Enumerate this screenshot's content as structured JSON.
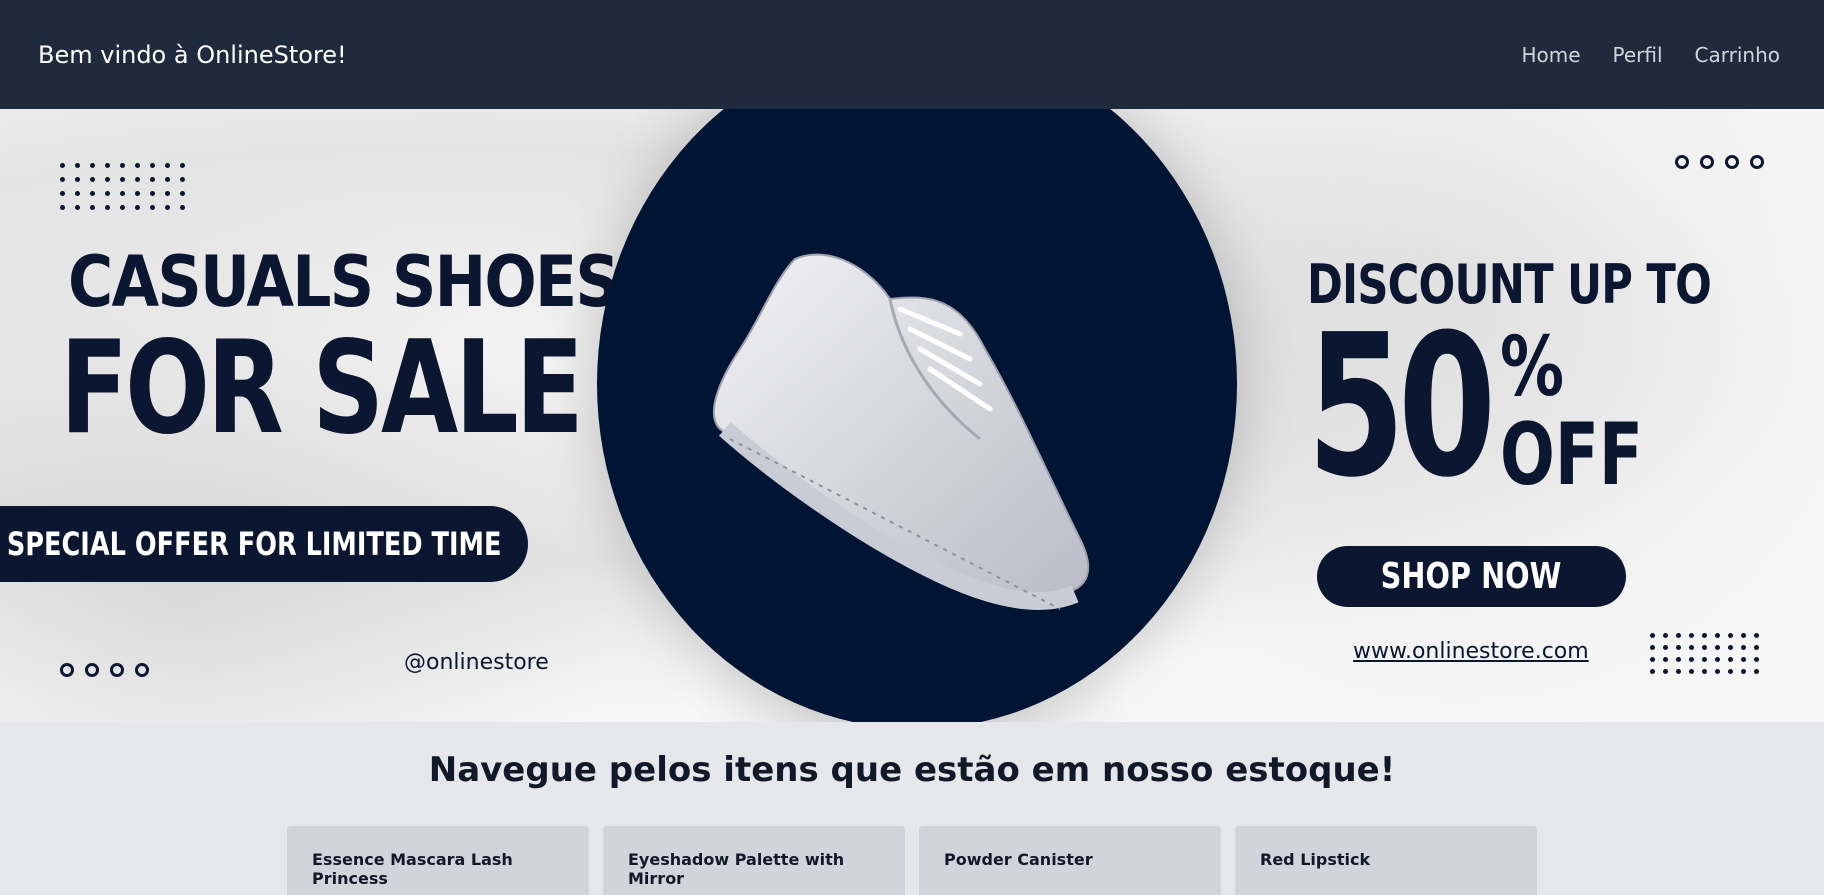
{
  "navbar": {
    "brand": "Bem vindo à OnlineStore!",
    "links": [
      "Home",
      "Perfil",
      "Carrinho"
    ]
  },
  "banner": {
    "heading_line1": "CASUALS SHOES",
    "heading_line2": "FOR SALE",
    "offer_label": "SPECIAL OFFER FOR LIMITED TIME",
    "social_handle": "@onlinestore",
    "discount_line": "DISCOUNT UP TO",
    "discount_value": "50",
    "discount_percent": "%",
    "discount_off": "OFF",
    "cta_label": "SHOP NOW",
    "website": "www.onlinestore.com"
  },
  "catalog": {
    "title": "Navegue pelos itens que estão em nosso estoque!",
    "products": [
      "Essence Mascara Lash Princess",
      "Eyeshadow Palette with Mirror",
      "Powder Canister",
      "Red Lipstick"
    ]
  },
  "colors": {
    "navbar_bg": "#1f2a3c",
    "banner_navy": "#0b1630",
    "page_bg": "#e5e7eb",
    "card_bg": "#d1d5db"
  }
}
